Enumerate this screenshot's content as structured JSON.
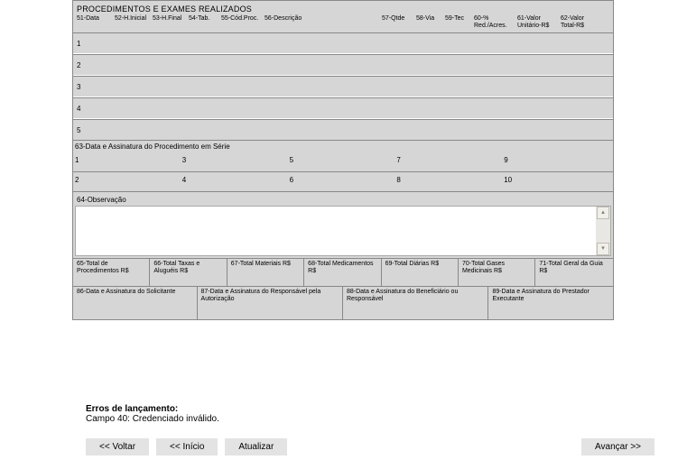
{
  "section_title": "PROCEDIMENTOS E EXAMES REALIZADOS",
  "headers": {
    "c51": "51-Data",
    "c52": "52-H.Inicial",
    "c53": "53-H.Final",
    "c54": "54-Tab.",
    "c55": "55-Cód.Proc.",
    "c56": "56-Descrição",
    "c57": "57-Qtde",
    "c58": "58-Via",
    "c59": "59-Tec",
    "c60": "60-% Red./Acres.",
    "c61": "61-Valor Unitário-R$",
    "c62": "62-Valor Total-R$"
  },
  "rows": [
    "1",
    "2",
    "3",
    "4",
    "5"
  ],
  "serie_label": "63-Data e Assinatura do Procedimento em Série",
  "serie_top": [
    "1",
    "3",
    "5",
    "7",
    "9"
  ],
  "serie_bot": [
    "2",
    "4",
    "6",
    "8",
    "10"
  ],
  "obs_label": "64-Observação",
  "totals": {
    "t65": "65-Total de Procedimentos R$",
    "t66": "66-Total Taxas e Aluguéis R$",
    "t67": "67-Total Materiais R$",
    "t68": "68-Total Medicamentos R$",
    "t69": "69-Total Diárias R$",
    "t70": "70-Total Gases Medicinais R$",
    "t71": "71-Total Geral da Guia R$"
  },
  "signatures": {
    "s86": "86-Data e Assinatura do Solicitante",
    "s87": "87-Data e Assinatura do Responsável pela Autorização",
    "s88": "88-Data e Assinatura do Beneficiário ou Responsável",
    "s89": "89-Data e Assinatura do Prestador Executante"
  },
  "errors_title": "Erros de lançamento:",
  "errors_line": "Campo 40: Credenciado inválido.",
  "buttons": {
    "back": "<< Voltar",
    "start": "<< Início",
    "update": "Atualizar",
    "next": "Avançar >>"
  }
}
